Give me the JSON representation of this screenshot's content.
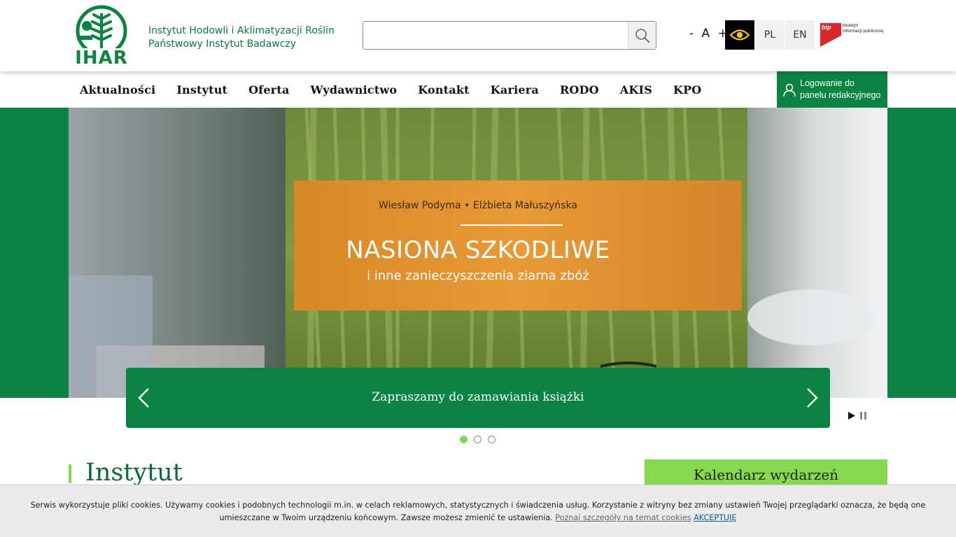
{
  "header": {
    "logo_text": "IHAR",
    "institute_name_line1": "Instytut Hodowli i Aklimatyzacji Roślin",
    "institute_name_line2": "Państwowy Instytut Badawczy",
    "search": {
      "value": "",
      "placeholder": ""
    },
    "font_size": {
      "decrease": "-",
      "normal": "A",
      "increase": "+"
    },
    "languages": [
      "PL",
      "EN"
    ],
    "bip": {
      "word": "bip",
      "text_line1": "biuletyn",
      "text_line2": "informacji publicznej"
    }
  },
  "nav": {
    "items": [
      "Aktualności",
      "Instytut",
      "Oferta",
      "Wydawnictwo",
      "Kontakt",
      "Kariera",
      "RODO",
      "AKIS",
      "KPO"
    ],
    "login_line1": "Logowanie do",
    "login_line2": "panelu redakcyjnego"
  },
  "slider": {
    "book_authors": "Wiesław Podyma  •  Elżbieta Małuszyńska",
    "book_title": "NASIONA SZKODLIWE",
    "book_subtitle": "i inne zanieczyszczenia ziarna zbóż",
    "caption": "Zapraszamy do zamawiania książki",
    "slide_count": 3,
    "active_slide": 1
  },
  "content": {
    "section_title": "Instytut",
    "calendar_title": "Kalendarz wydarzeń"
  },
  "cookie": {
    "text": "Serwis wykorzystuje pliki cookies. Używamy cookies i podobnych technologii m.in. w celach reklamowych, statystycznych i świadczenia usług. Korzystanie z witryny bez zmiany ustawień Twojej przeglądarki oznacza, że będą one umieszczane w Twoim urządzeniu końcowym. Zawsze możesz zmienić te ustawienia.",
    "details_link": "Poznaj szczegóły na temat cookies",
    "accept": "AKCEPTUJĘ"
  },
  "colors": {
    "brand_green": "#0b8443",
    "accent_lime": "#7ed957",
    "book_orange": "#e59330"
  }
}
